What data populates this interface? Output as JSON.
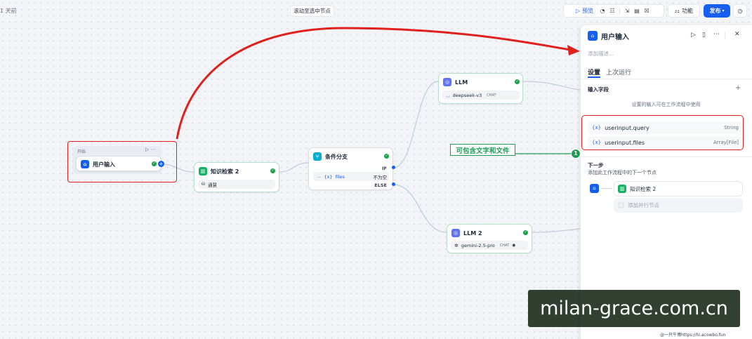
{
  "toolbar": {
    "saved_status": "1 天前",
    "scroll_to_selected": "滚动至选中节点",
    "preview": "预览",
    "features": "功能",
    "publish": "发布"
  },
  "nodes": {
    "start": {
      "group_label": "开始",
      "title": "用户输入"
    },
    "knowledge": {
      "title": "知识检索 2",
      "dataset": "通慧"
    },
    "condition": {
      "title": "条件分支",
      "branch_if": "IF",
      "variable": "files",
      "variable_prefix": "{x}",
      "operator": "不为空",
      "branch_else": "ELSE"
    },
    "llm1": {
      "title": "LLM",
      "model": "deepseek-v3",
      "model_tag": "CHAT"
    },
    "llm2": {
      "title": "LLM 2",
      "model": "gemini-2.5-pro",
      "model_tag": "CHAT"
    }
  },
  "annotation": {
    "text": "可包含文字和文件",
    "badge": "1"
  },
  "panel": {
    "title": "用户输入",
    "description_placeholder": "添加描述...",
    "tabs": [
      {
        "label": "设置"
      },
      {
        "label": "上次运行"
      }
    ],
    "input_fields_label": "输入字段",
    "input_fields_hint": "设置的输入可在工作流程中使用",
    "fields": [
      {
        "prefix": "{x}",
        "name": "userinput.query",
        "type": "String"
      },
      {
        "prefix": "{x}",
        "name": "userinput.files",
        "type": "Array[File]"
      }
    ],
    "next_step_label": "下一步",
    "next_step_hint": "添加此工作流程中的下一个节点",
    "next_node": "知识检索 2",
    "add_parallel": "添加并行节点"
  },
  "watermark": {
    "text": "milan-grace.com.cn",
    "credit": "@一只牛博https://hi.acowbo.fun"
  },
  "colors": {
    "accent": "#155eef",
    "success": "#16a34a",
    "annotation_red": "#e0201c",
    "annotation_green": "#1f9d55",
    "llm_icon": "#6172f3",
    "knowledge_icon": "#16b364",
    "condition_icon": "#06aed4"
  }
}
